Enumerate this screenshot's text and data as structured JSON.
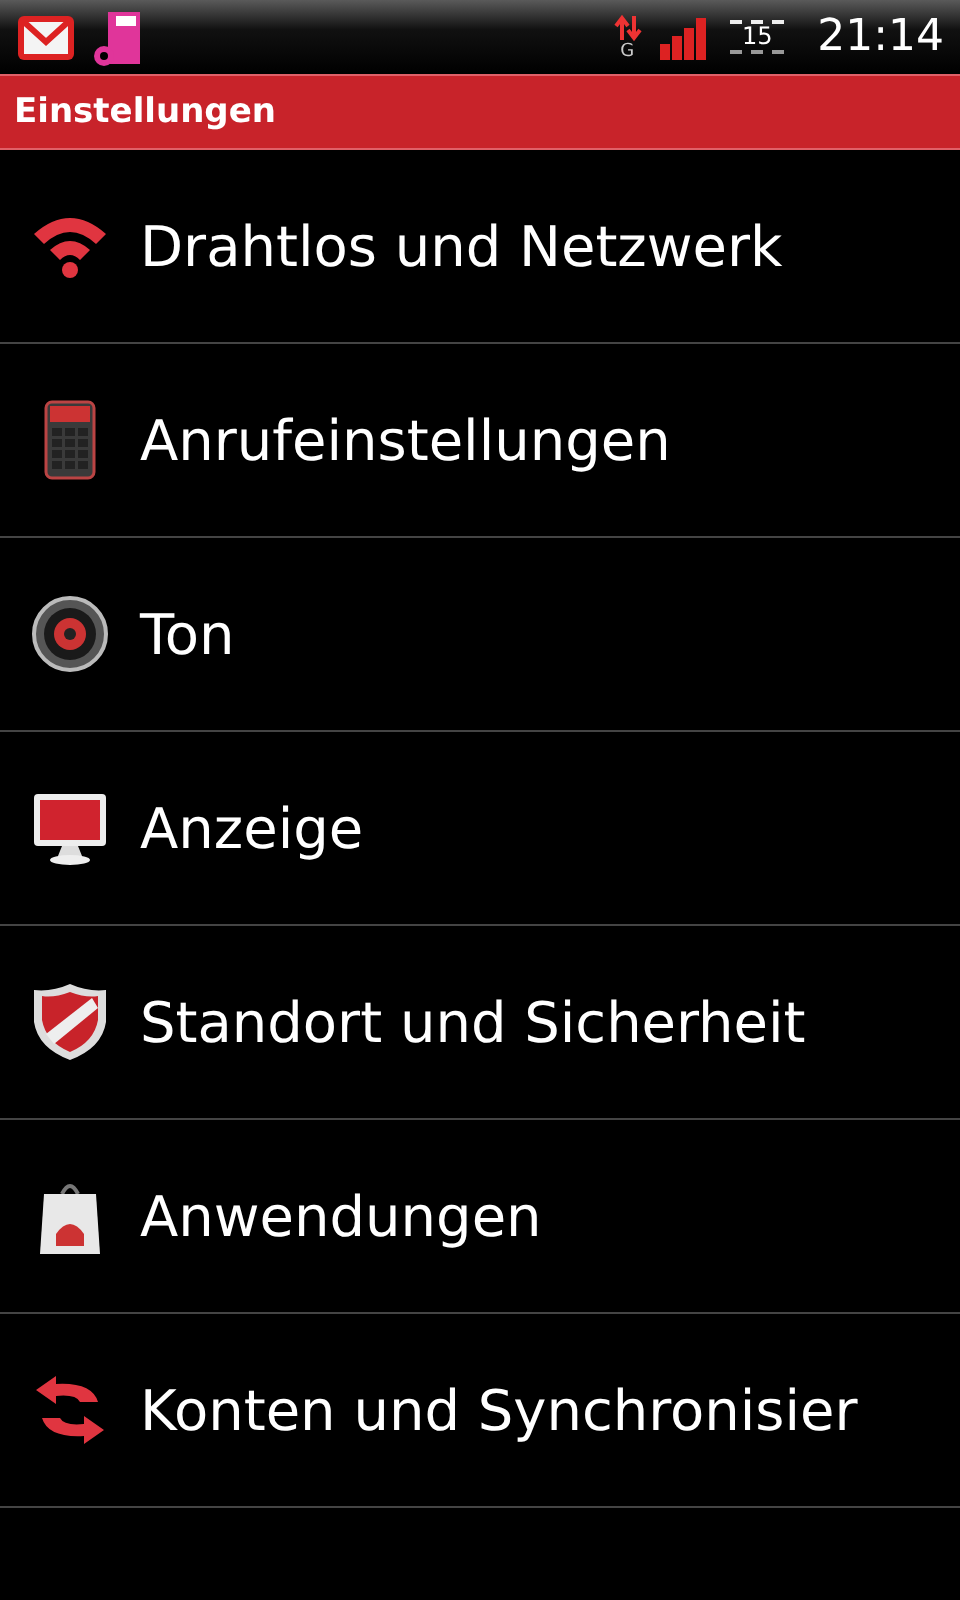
{
  "status_bar": {
    "network_type": "G",
    "battery": "15",
    "time": "21:14"
  },
  "title": "Einstellungen",
  "items": [
    {
      "label": "Drahtlos und Netzwerk"
    },
    {
      "label": "Anrufeinstellungen"
    },
    {
      "label": "Ton"
    },
    {
      "label": "Anzeige"
    },
    {
      "label": "Standort und Sicherheit"
    },
    {
      "label": "Anwendungen"
    },
    {
      "label": "Konten und Synchronisier"
    }
  ]
}
